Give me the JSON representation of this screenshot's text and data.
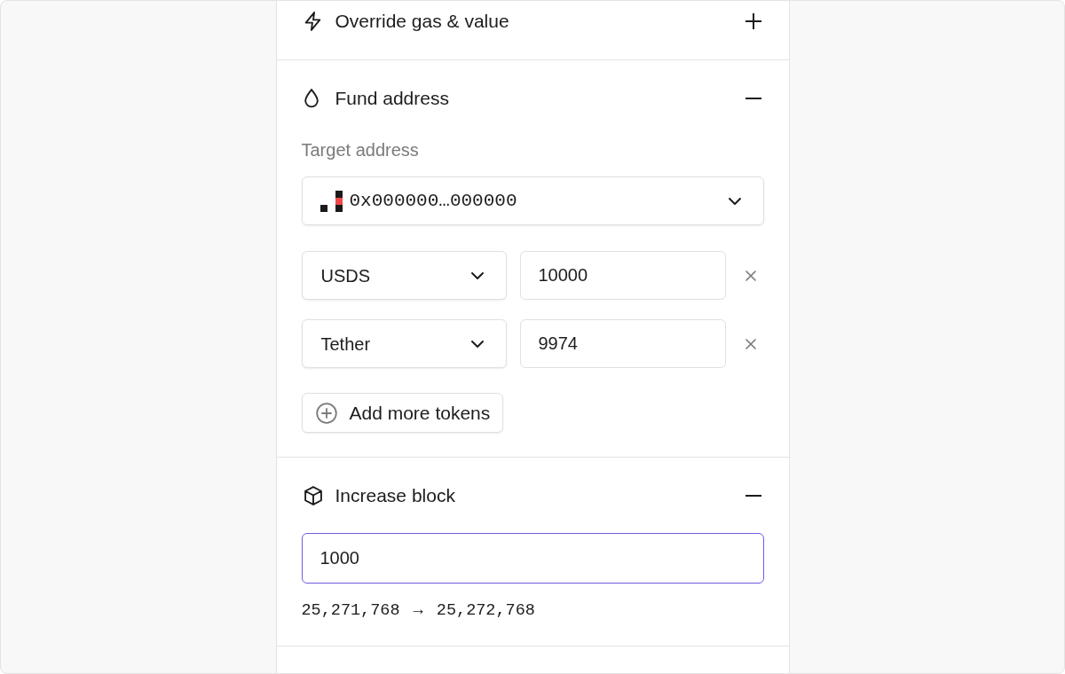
{
  "sections": [
    {
      "kind": "override_gas",
      "title": "Override gas & value",
      "expanded": false
    },
    {
      "kind": "fund_address",
      "title": "Fund address",
      "expanded": true,
      "target_label": "Target address",
      "address": "0x000000…000000",
      "tokens": [
        {
          "token": "USDS",
          "amount": "10000"
        },
        {
          "token": "Tether",
          "amount": "9974"
        }
      ],
      "add_button": "Add more tokens"
    },
    {
      "kind": "increase_block",
      "title": "Increase block",
      "expanded": true,
      "input": {
        "value": "1000",
        "focused": true
      },
      "block_change": "25,271,768 → 25,272,768"
    }
  ]
}
